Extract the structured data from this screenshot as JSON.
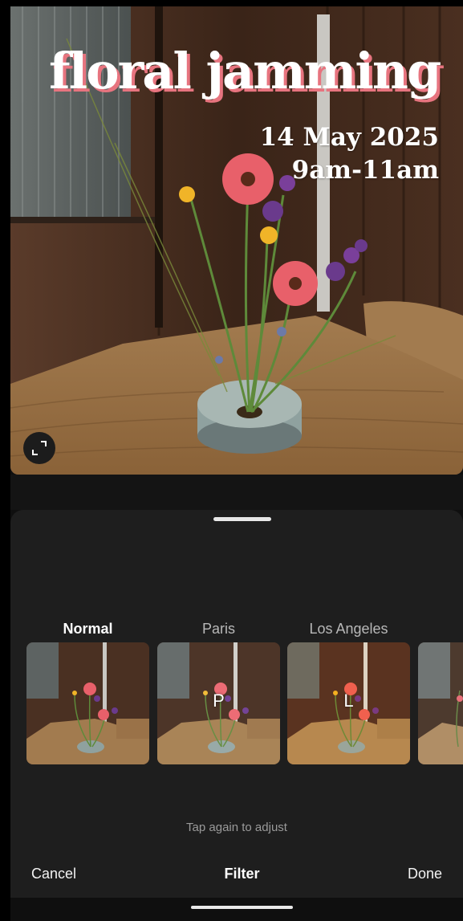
{
  "story": {
    "title": "floral jamming",
    "date": "14 May 2025",
    "time": "9am-11am"
  },
  "filters": {
    "items": [
      {
        "label": "Normal",
        "active": true,
        "letter": ""
      },
      {
        "label": "Paris",
        "active": false,
        "letter": "P"
      },
      {
        "label": "Los Angeles",
        "active": false,
        "letter": "L"
      },
      {
        "label": "",
        "active": false,
        "letter": ""
      }
    ],
    "hint": "Tap again to adjust"
  },
  "footer": {
    "cancel_label": "Cancel",
    "title": "Filter",
    "done_label": "Done"
  },
  "icons": {
    "expand": "expand-icon"
  },
  "colors": {
    "sheet_bg": "#1e1e1e",
    "title_shadow": "#e7747f"
  }
}
